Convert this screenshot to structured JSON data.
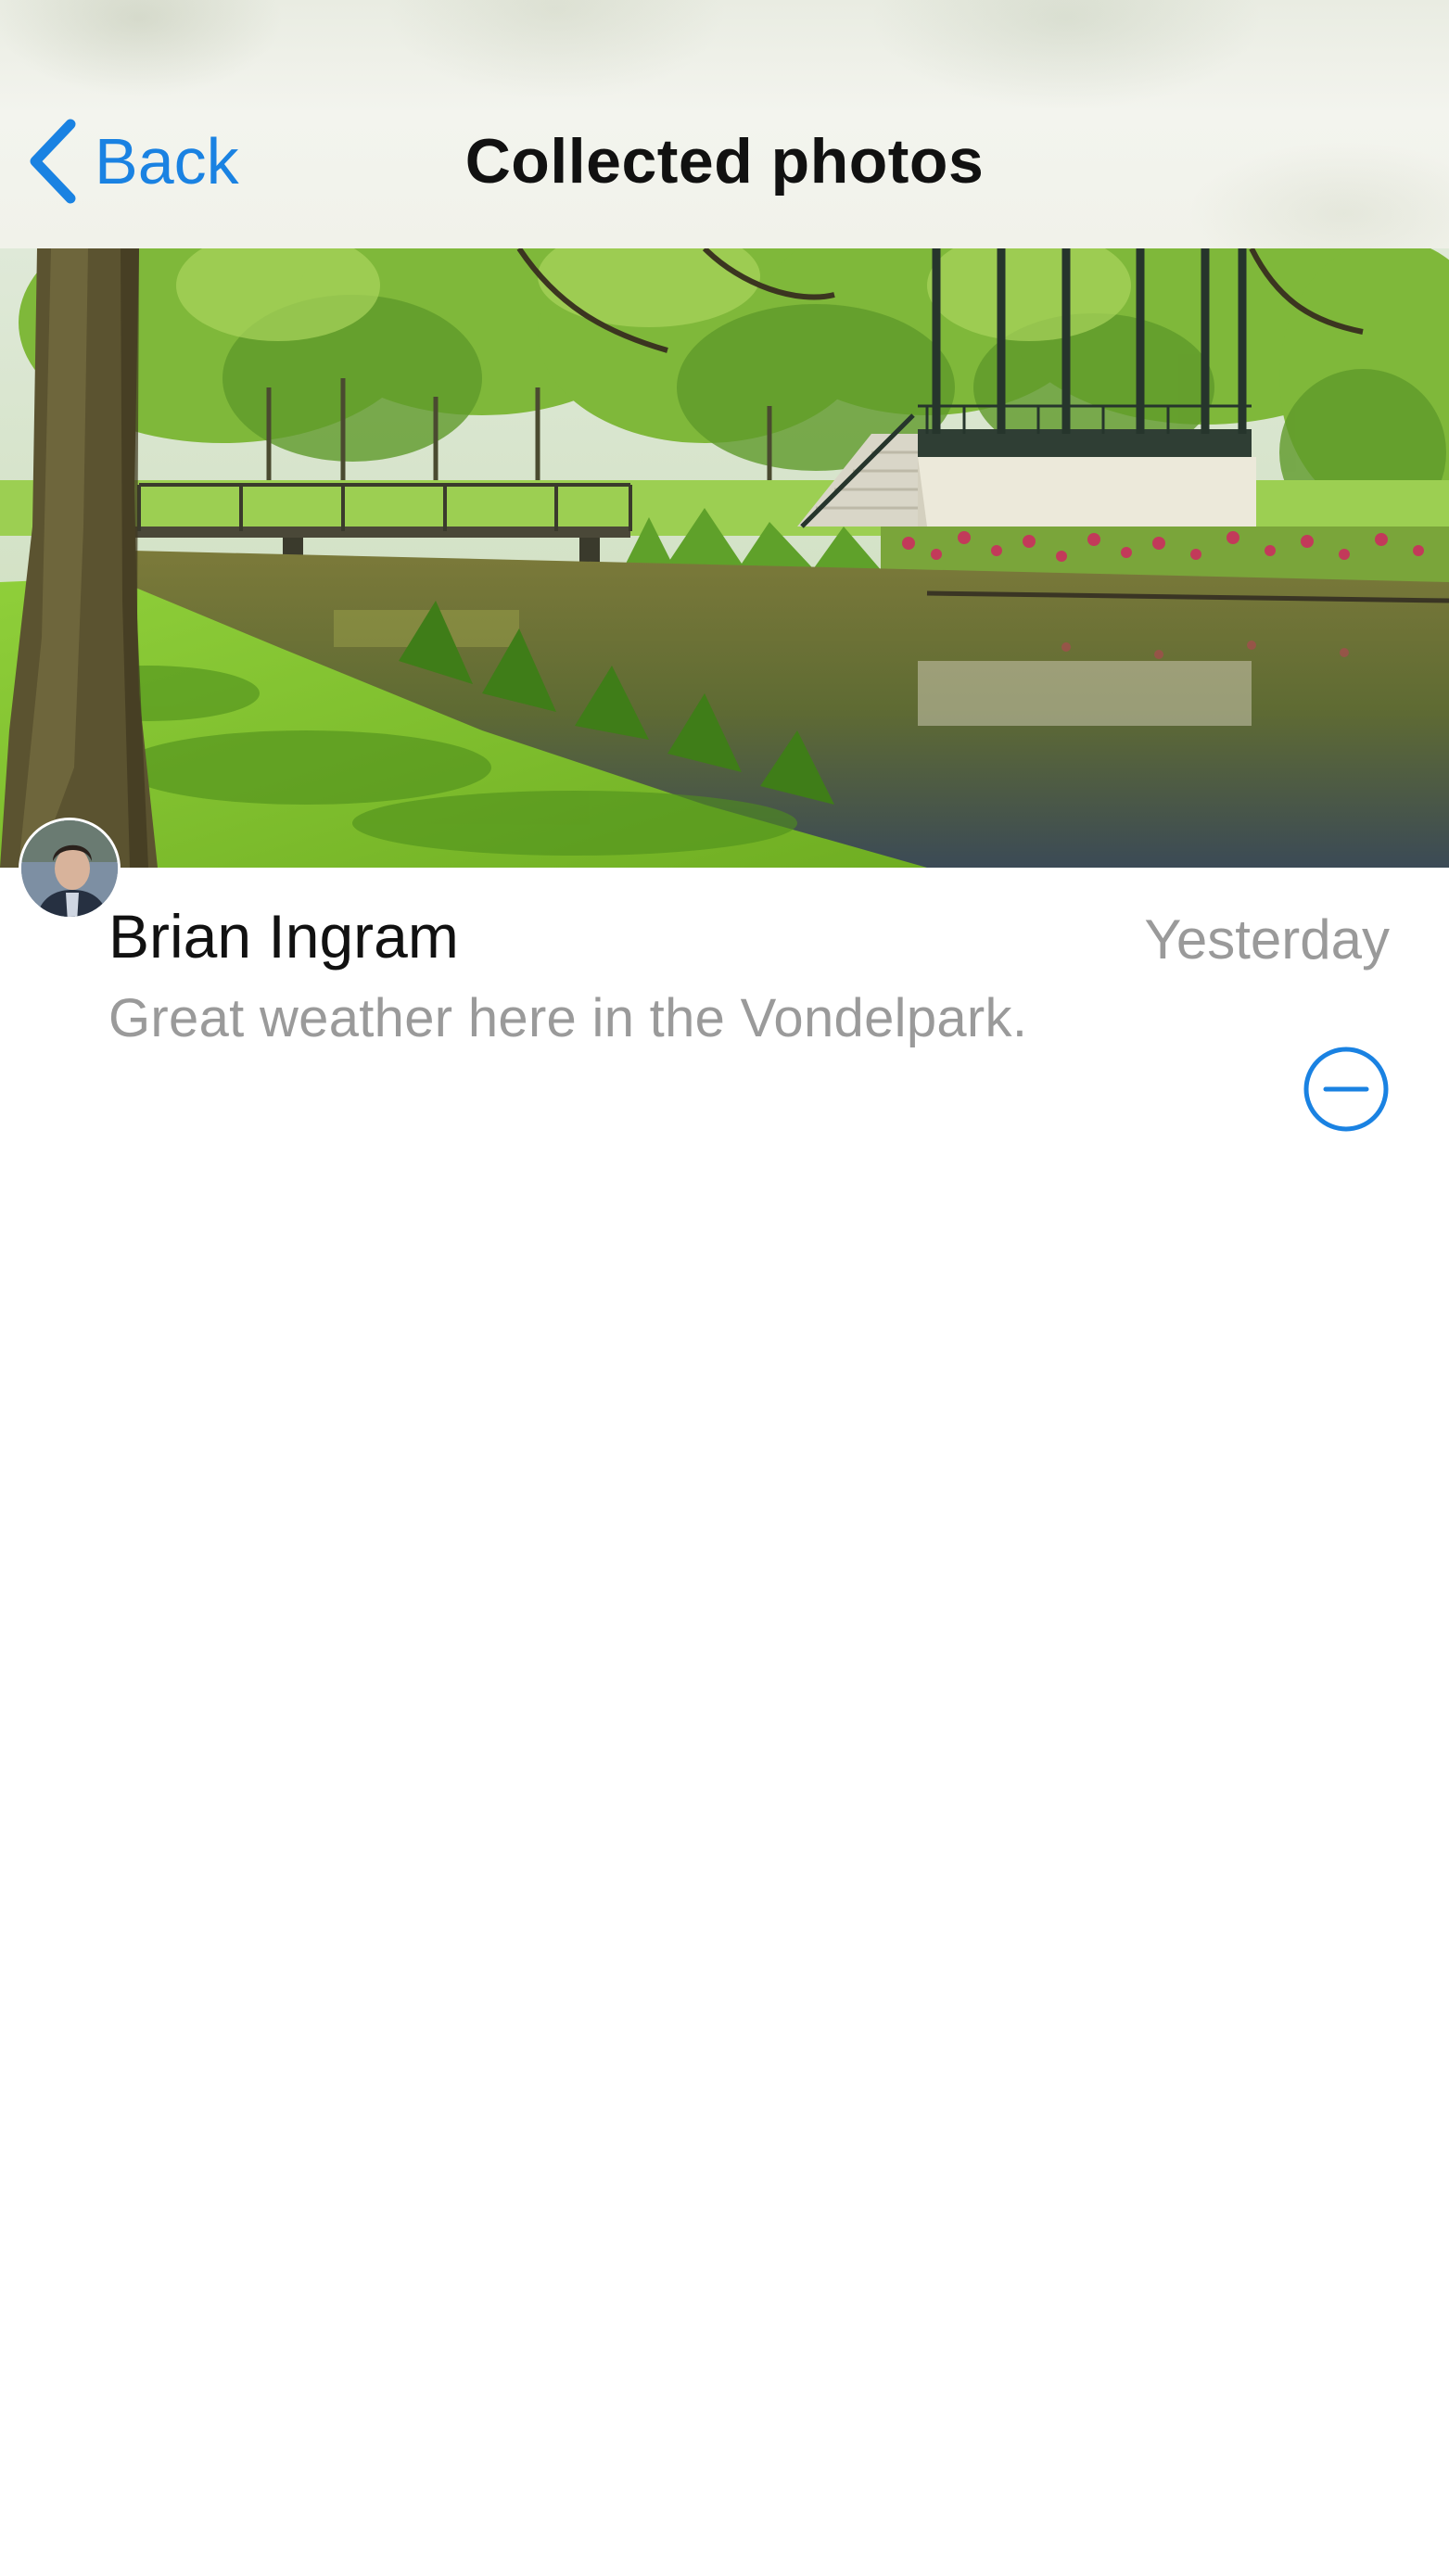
{
  "navbar": {
    "back_label": "Back",
    "back_icon": "chevron-left-icon",
    "title": "Collected photos"
  },
  "photo": {
    "subject": "park-pond-bandstand-photo"
  },
  "post": {
    "author": "Brian Ingram",
    "timestamp": "Yesterday",
    "caption": "Great weather here in the Vondelpark.",
    "remove_icon": "minus-circle-icon"
  },
  "colors": {
    "accent": "#1a82e2",
    "secondary_text": "#9a9a9a",
    "primary_text": "#111111"
  }
}
